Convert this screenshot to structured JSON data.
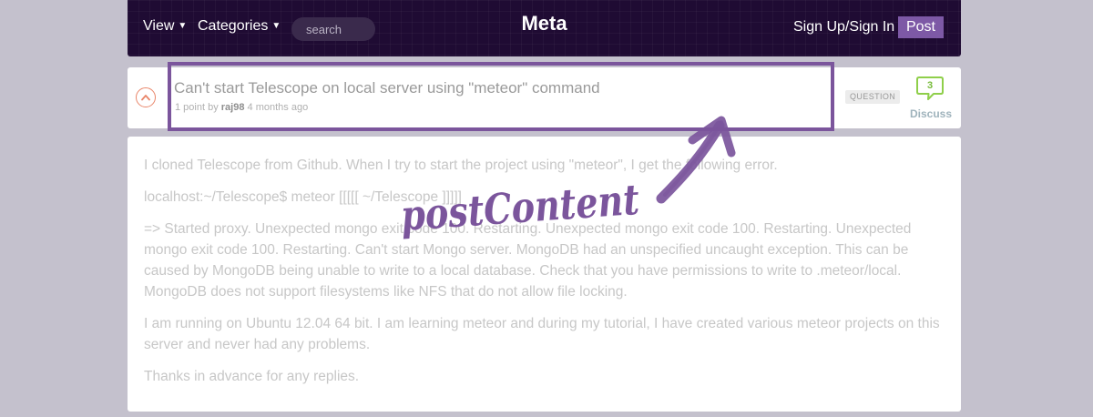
{
  "header": {
    "nav_view": "View",
    "nav_categories": "Categories",
    "search_placeholder": "search",
    "site_title": "Meta",
    "signin": "Sign Up/Sign In",
    "post_button": "Post"
  },
  "post": {
    "title": "Can't start Telescope on local server using \"meteor\" command",
    "points": "1 point by",
    "author": "raj98",
    "time_ago": "4 months ago",
    "category": "QUESTION",
    "comment_count": "3",
    "discuss_label": "Discuss"
  },
  "body": {
    "paragraphs": [
      "I cloned Telescope from Github. When I try to start the project using \"meteor\", I get the following error.",
      "localhost:~/Telescope$ meteor [[[[[ ~/Telescope ]]]]]",
      "=> Started proxy. Unexpected mongo exit code 100. Restarting. Unexpected mongo exit code 100. Restarting. Unexpected mongo exit code 100. Restarting. Can't start Mongo server. MongoDB had an unspecified uncaught exception. This can be caused by MongoDB being unable to write to a local database. Check that you have permissions to write to .meteor/local. MongoDB does not support filesystems like NFS that do not allow file locking.",
      "I am running on Ubuntu 12.04 64 bit. I am learning meteor and during my tutorial, I have created various meteor projects on this server and never had any problems.",
      "Thanks in advance for any replies."
    ]
  },
  "annotation": {
    "label": "postContent",
    "color": "#7b559c"
  },
  "colors": {
    "header_bg": "#1f0b33",
    "accent": "#7d59a6",
    "upvote": "#e9866a",
    "comment_green": "#77bb3a"
  },
  "icons": {
    "upvote": "chevron-up-icon",
    "comments": "speech-bubble-icon",
    "annotation": "hand-drawn-arrow-icon"
  }
}
